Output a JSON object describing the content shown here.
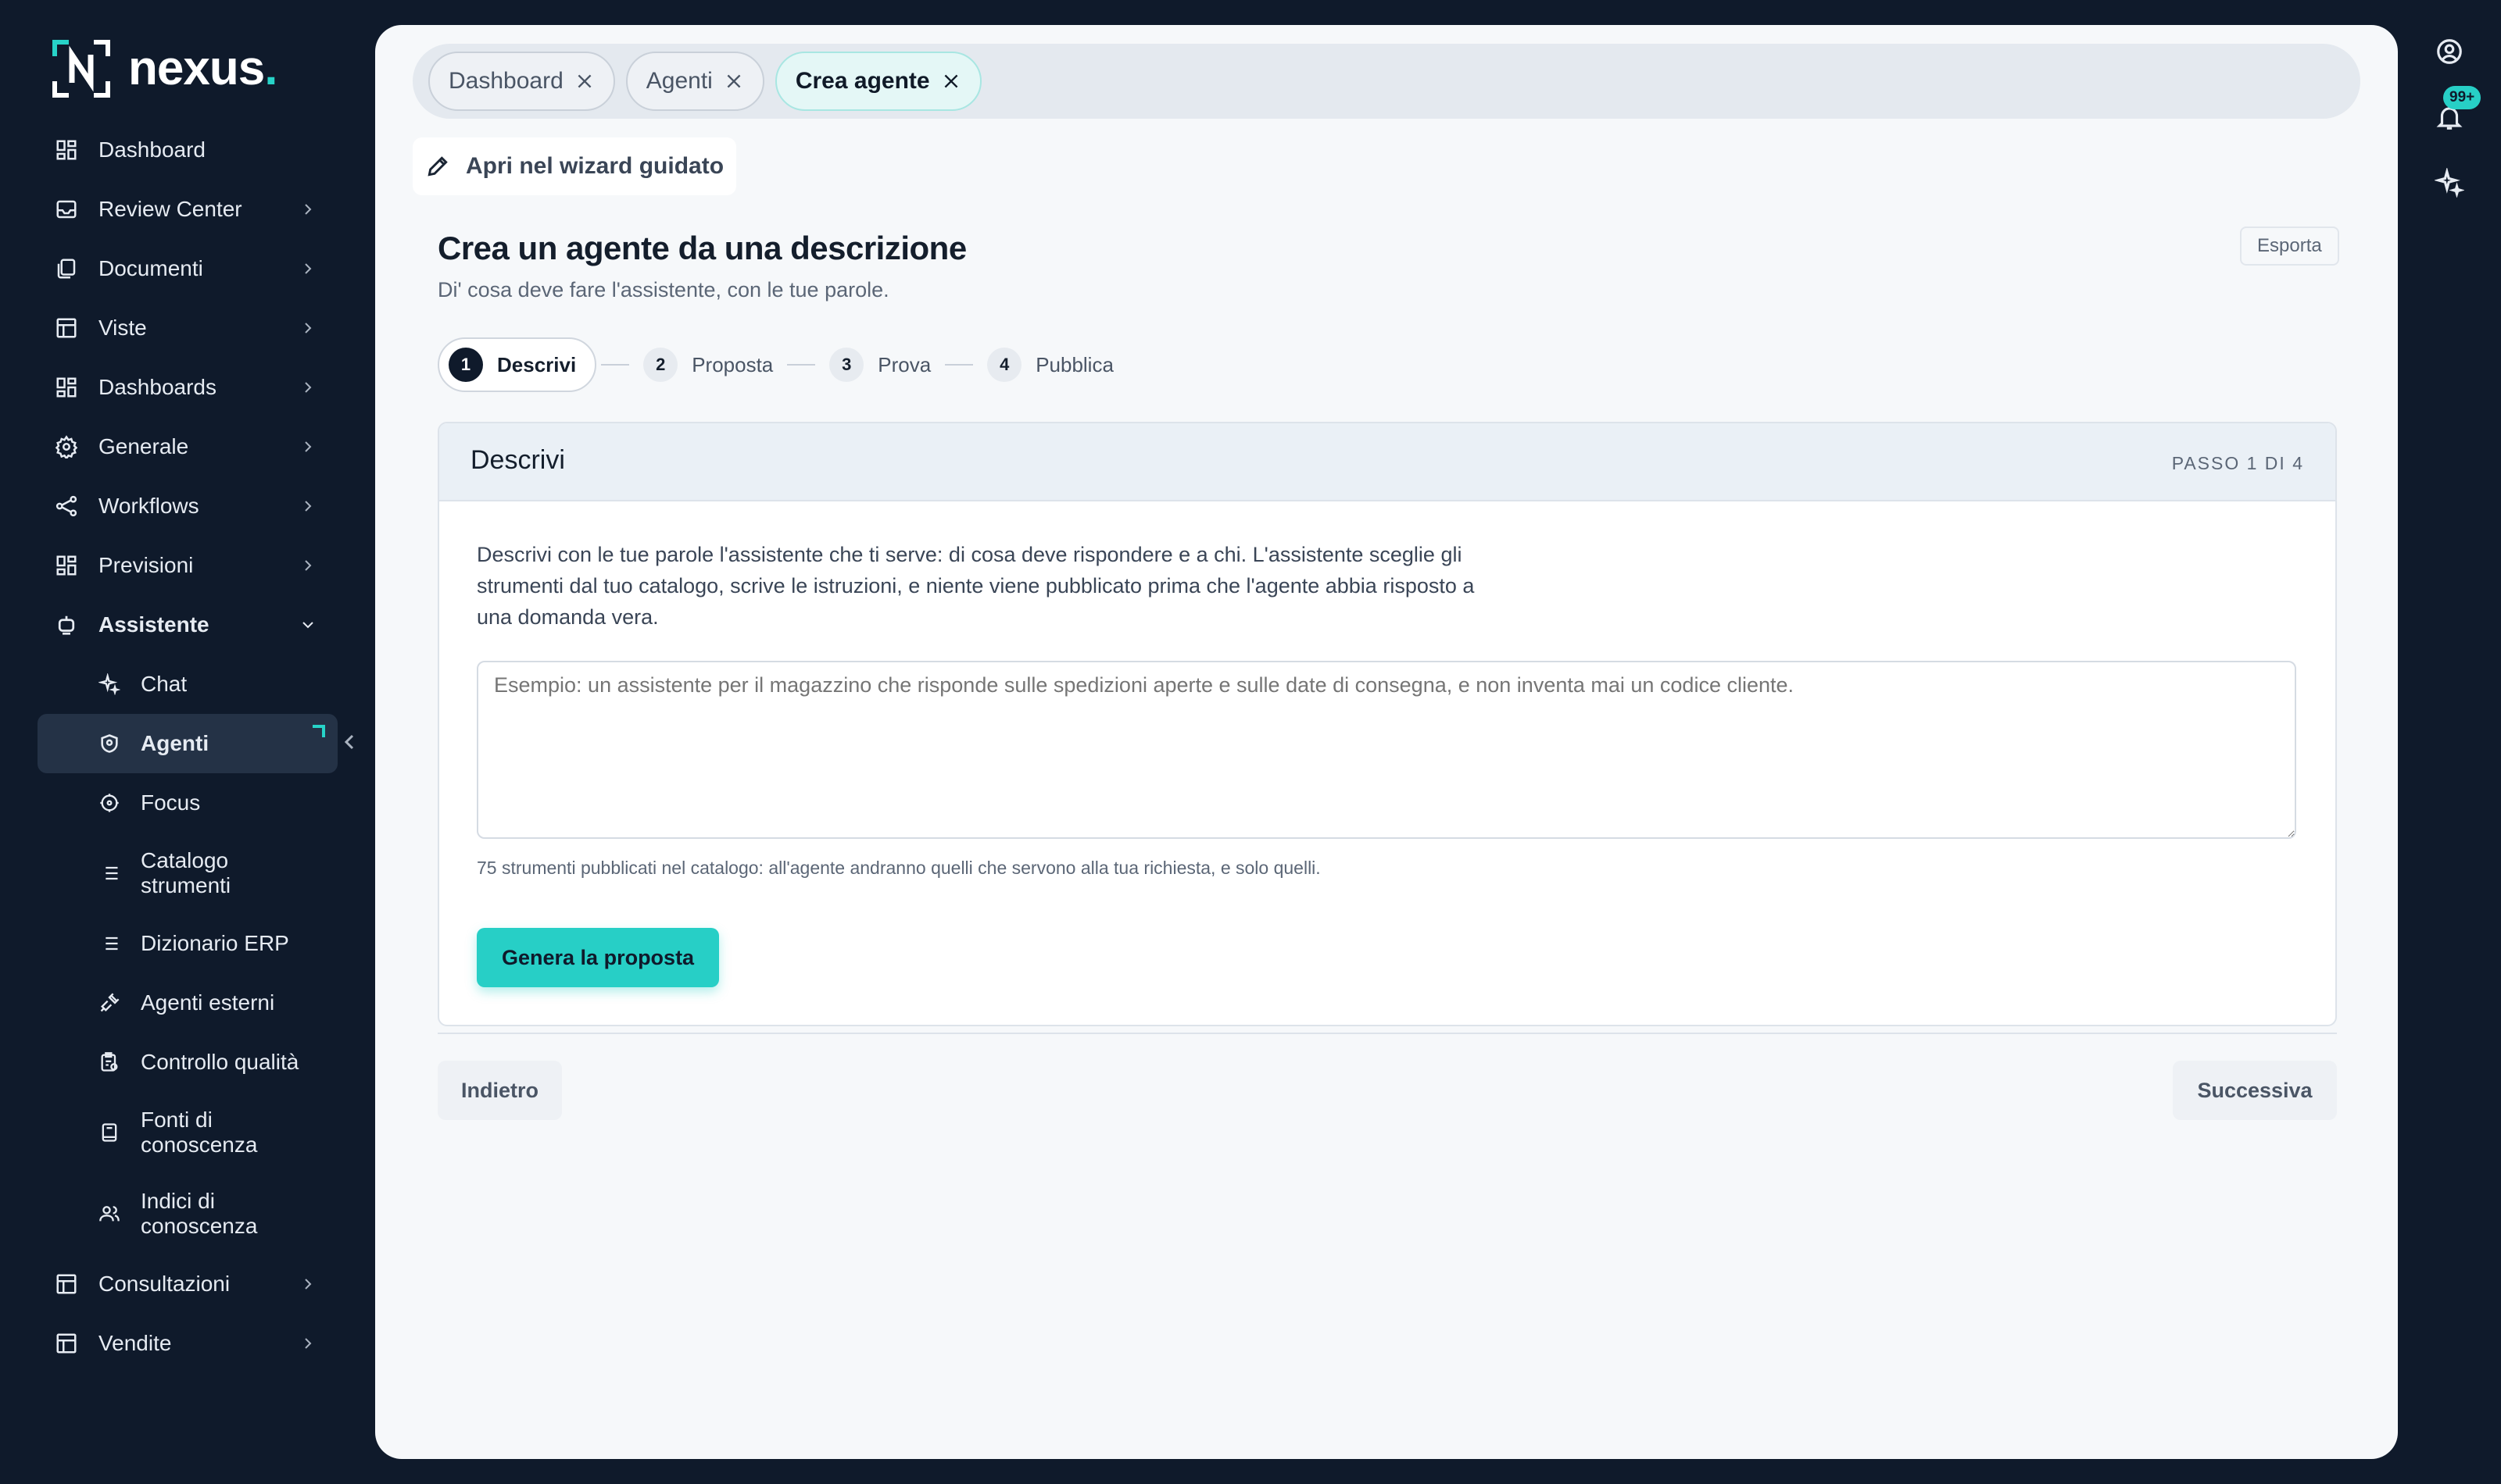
{
  "brand": {
    "name": "nexus",
    "dot": ".",
    "accent": "#27d3c8"
  },
  "sidebar": {
    "items": [
      {
        "label": "Dashboard",
        "icon": "grid-icon"
      },
      {
        "label": "Review Center",
        "icon": "inbox-icon"
      },
      {
        "label": "Documenti",
        "icon": "documents-icon"
      },
      {
        "label": "Viste",
        "icon": "table-icon"
      },
      {
        "label": "Dashboards",
        "icon": "grid-icon"
      },
      {
        "label": "Generale",
        "icon": "gear-icon"
      },
      {
        "label": "Workflows",
        "icon": "share-icon"
      },
      {
        "label": "Previsioni",
        "icon": "grid-icon"
      },
      {
        "label": "Assistente",
        "icon": "bot-icon"
      }
    ],
    "sub_items": [
      {
        "label": "Chat",
        "icon": "sparkle-icon"
      },
      {
        "label": "Agenti",
        "icon": "shield-icon"
      },
      {
        "label": "Focus",
        "icon": "target-icon"
      },
      {
        "label": "Catalogo strumenti",
        "icon": "list-icon"
      },
      {
        "label": "Dizionario ERP",
        "icon": "list-icon"
      },
      {
        "label": "Agenti esterni",
        "icon": "plug-icon"
      },
      {
        "label": "Controllo qualità",
        "icon": "checklist-icon"
      },
      {
        "label": "Fonti di conoscenza",
        "icon": "book-icon"
      },
      {
        "label": "Indici di conoscenza",
        "icon": "users-icon"
      }
    ],
    "bottom_items": [
      {
        "label": "Consultazioni",
        "icon": "table-icon"
      },
      {
        "label": "Vendite",
        "icon": "table-icon"
      }
    ]
  },
  "tabs": [
    {
      "label": "Dashboard"
    },
    {
      "label": "Agenti"
    },
    {
      "label": "Crea agente"
    }
  ],
  "wizard_button": "Apri nel wizard guidato",
  "page": {
    "title": "Crea un agente da una descrizione",
    "subtitle": "Di' cosa deve fare l'assistente, con le tue parole.",
    "export": "Esporta"
  },
  "steps": [
    {
      "num": "1",
      "label": "Descrivi"
    },
    {
      "num": "2",
      "label": "Proposta"
    },
    {
      "num": "3",
      "label": "Prova"
    },
    {
      "num": "4",
      "label": "Pubblica"
    }
  ],
  "card": {
    "title": "Descrivi",
    "step_indicator": "PASSO 1 DI 4",
    "description": "Descrivi con le tue parole l'assistente che ti serve: di cosa deve rispondere e a chi. L'assistente sceglie gli strumenti dal tuo catalogo, scrive le istruzioni, e niente viene pubblicato prima che l'agente abbia risposto a una domanda vera.",
    "textarea_placeholder": "Esempio: un assistente per il magazzino che risponde sulle spedizioni aperte e sulle date di consegna, e non inventa mai un codice cliente.",
    "hint": "75 strumenti pubblicati nel catalogo: all'agente andranno quelli che servono alla tua richiesta, e solo quelli.",
    "generate": "Genera la proposta"
  },
  "footer": {
    "back": "Indietro",
    "next": "Successiva"
  },
  "rail": {
    "badge": "99+"
  }
}
